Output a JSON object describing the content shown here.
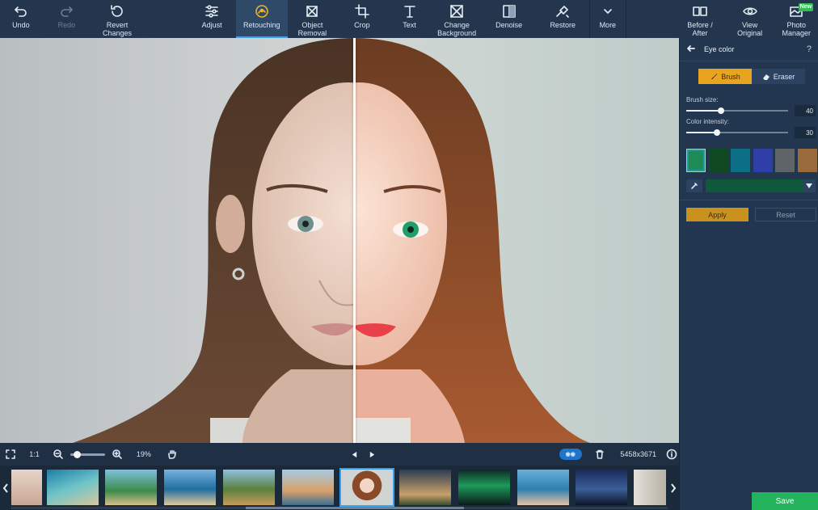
{
  "toolbar": {
    "undo": "Undo",
    "redo": "Redo",
    "revert": "Revert\nChanges",
    "adjust": "Adjust",
    "retouching": "Retouching",
    "object_removal": "Object\nRemoval",
    "crop": "Crop",
    "text": "Text",
    "change_background": "Change\nBackground",
    "denoise": "Denoise",
    "restore": "Restore",
    "more": "More",
    "before_after": "Before /\nAfter",
    "view_original": "View\nOriginal",
    "photo_manager": "Photo\nManager",
    "new_badge": "New"
  },
  "bottom_bar": {
    "ratio": "1:1",
    "zoom": "19%",
    "dimensions": "5458x3671",
    "zoom_level": 0.19
  },
  "panel": {
    "title": "Eye color",
    "help": "?",
    "brush": "Brush",
    "eraser": "Eraser",
    "brush_size_label": "Brush size:",
    "brush_size": "40",
    "brush_size_fraction": 0.34,
    "color_intensity_label": "Color intensity:",
    "color_intensity": "30",
    "color_intensity_fraction": 0.3,
    "swatches": [
      "#1f8a55",
      "#0f4a22",
      "#0d6f86",
      "#2e3fa8",
      "#5e6468",
      "#9a6b3a"
    ],
    "selected_swatch": 0,
    "selected_color": "#0f5a3a",
    "apply": "Apply",
    "reset": "Reset"
  },
  "save": "Save",
  "colors": {
    "accent_blue": "#3aa0f0",
    "brush_active": "#e8a41f",
    "apply": "#c9921e",
    "save": "#22b35c"
  }
}
